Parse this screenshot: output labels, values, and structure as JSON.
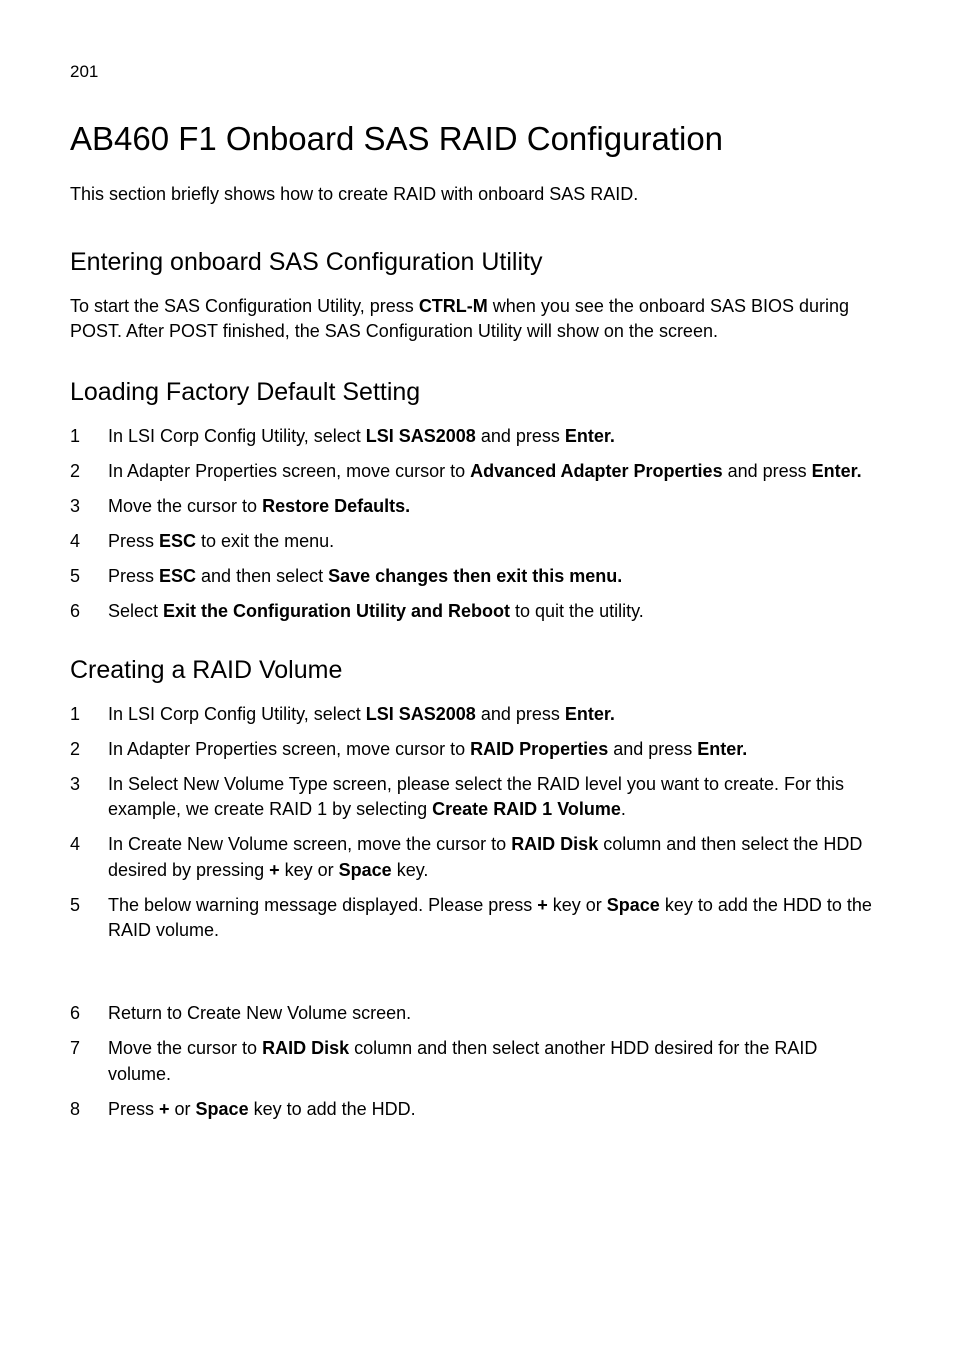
{
  "pageNumber": "201",
  "title": "AB460 F1 Onboard SAS RAID Configuration",
  "intro": "This section briefly shows how to create RAID with onboard SAS RAID.",
  "section1": {
    "heading": "Entering onboard SAS Configuration Utility",
    "para_parts": [
      {
        "text": "To start the SAS Configuration Utility, press "
      },
      {
        "text": "CTRL-M",
        "bold": true
      },
      {
        "text": " when you see the onboard SAS BIOS during POST. After POST finished, the SAS Configuration Utility will show on the screen."
      }
    ]
  },
  "section2": {
    "heading": "Loading Factory Default Setting",
    "items": [
      {
        "num": "1",
        "parts": [
          {
            "text": "In LSI Corp Config Utility, select "
          },
          {
            "text": "LSI SAS2008",
            "bold": true
          },
          {
            "text": " and press "
          },
          {
            "text": "Enter.",
            "bold": true
          }
        ]
      },
      {
        "num": "2",
        "parts": [
          {
            "text": "In Adapter Properties screen, move cursor to "
          },
          {
            "text": "Advanced Adapter Properties",
            "bold": true
          },
          {
            "text": " and press "
          },
          {
            "text": "Enter.",
            "bold": true
          }
        ]
      },
      {
        "num": "3",
        "parts": [
          {
            "text": "Move the cursor to "
          },
          {
            "text": "Restore Defaults.",
            "bold": true
          }
        ]
      },
      {
        "num": "4",
        "parts": [
          {
            "text": "Press "
          },
          {
            "text": "ESC",
            "bold": true
          },
          {
            "text": " to exit the menu."
          }
        ]
      },
      {
        "num": "5",
        "parts": [
          {
            "text": "Press "
          },
          {
            "text": "ESC",
            "bold": true
          },
          {
            "text": " and then select "
          },
          {
            "text": "Save changes then exit this menu.",
            "bold": true
          }
        ]
      },
      {
        "num": "6",
        "parts": [
          {
            "text": "Select "
          },
          {
            "text": "Exit the Configuration Utility and Reboot",
            "bold": true
          },
          {
            "text": " to quit the utility."
          }
        ]
      }
    ]
  },
  "section3": {
    "heading": "Creating a RAID Volume",
    "items": [
      {
        "num": "1",
        "parts": [
          {
            "text": "In LSI Corp Config Utility, select "
          },
          {
            "text": "LSI SAS2008",
            "bold": true
          },
          {
            "text": " and press "
          },
          {
            "text": "Enter.",
            "bold": true
          }
        ]
      },
      {
        "num": "2",
        "parts": [
          {
            "text": "In Adapter Properties screen, move cursor to "
          },
          {
            "text": "RAID Properties",
            "bold": true
          },
          {
            "text": " and press "
          },
          {
            "text": "Enter.",
            "bold": true
          }
        ]
      },
      {
        "num": "3",
        "parts": [
          {
            "text": "In Select New Volume Type screen, please select the RAID level you want to create. For this example, we create RAID 1 by selecting "
          },
          {
            "text": "Create RAID 1 Volume",
            "bold": true
          },
          {
            "text": "."
          }
        ]
      },
      {
        "num": "4",
        "parts": [
          {
            "text": "In Create New Volume screen, move the cursor to "
          },
          {
            "text": "RAID Disk",
            "bold": true
          },
          {
            "text": " column and then select the HDD desired by pressing "
          },
          {
            "text": "+",
            "bold": true
          },
          {
            "text": " key or "
          },
          {
            "text": "Space",
            "bold": true
          },
          {
            "text": " key."
          }
        ]
      },
      {
        "num": "5",
        "parts": [
          {
            "text": "The below warning message displayed. Please press "
          },
          {
            "text": "+",
            "bold": true
          },
          {
            "text": " key or "
          },
          {
            "text": "Space",
            "bold": true
          },
          {
            "text": " key to add the HDD to the RAID volume."
          }
        ],
        "extraGap": true
      },
      {
        "num": "6",
        "parts": [
          {
            "text": "Return to Create New Volume screen."
          }
        ]
      },
      {
        "num": "7",
        "parts": [
          {
            "text": "Move the cursor to "
          },
          {
            "text": "RAID Disk",
            "bold": true
          },
          {
            "text": " column and then select another HDD desired for the RAID volume."
          }
        ]
      },
      {
        "num": "8",
        "parts": [
          {
            "text": "Press "
          },
          {
            "text": "+",
            "bold": true
          },
          {
            "text": " or "
          },
          {
            "text": "Space",
            "bold": true
          },
          {
            "text": " key to add the HDD."
          }
        ]
      }
    ]
  }
}
